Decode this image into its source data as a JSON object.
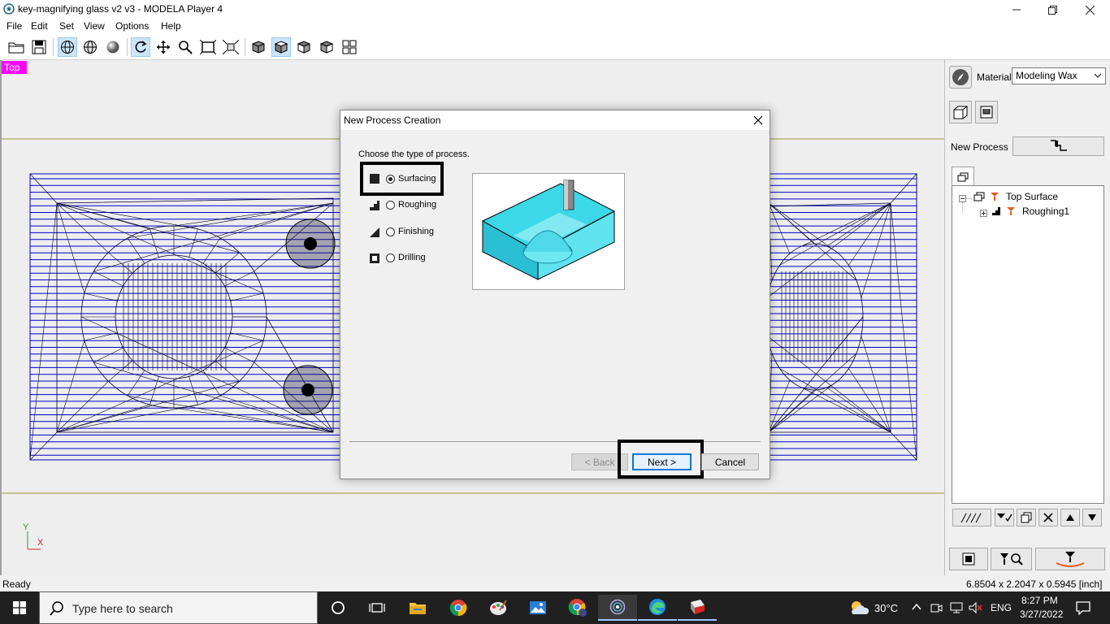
{
  "window": {
    "title": "key-magnifying glass v2 v3 - MODELA Player 4"
  },
  "menu": [
    "File",
    "Edit",
    "Set",
    "View",
    "Options",
    "Help"
  ],
  "viewport": {
    "view_label": "Top",
    "axis_y": "Y",
    "axis_x": "X"
  },
  "right_panel": {
    "material_label": "Material",
    "material_value": "Modeling Wax",
    "new_process_label": "New Process",
    "tree": {
      "root": "Top Surface",
      "child": "Roughing1"
    }
  },
  "dialog": {
    "title": "New Process Creation",
    "prompt": "Choose the type of process.",
    "options": [
      "Surfacing",
      "Roughing",
      "Finishing",
      "Drilling"
    ],
    "selected": "Surfacing",
    "back_label": "< Back",
    "next_label": "Next >",
    "cancel_label": "Cancel"
  },
  "status": {
    "left": "Ready",
    "dimensions": "6.8504 x 2.2047 x 0.5945 [inch]"
  },
  "taskbar": {
    "search_placeholder": "Type here to search",
    "weather": "30°C",
    "language": "ENG",
    "time": "8:27 PM",
    "date": "3/27/2022"
  },
  "colors": {
    "accent_magenta": "#ff00ff",
    "mesh_blue": "#0000cc",
    "preview_cyan": "#3cd8e8",
    "taskbar": "#202020"
  }
}
